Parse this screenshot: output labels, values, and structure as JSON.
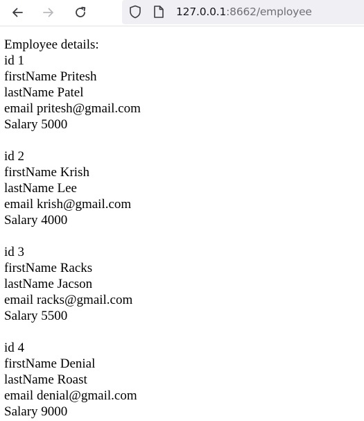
{
  "browser": {
    "url_host": "127.0.0.1",
    "url_rest": ":8662/employee"
  },
  "page": {
    "heading": "Employee details:",
    "employees": [
      {
        "id": "id 1",
        "first": "firstName Pritesh",
        "last": "lastName Patel",
        "email": "email pritesh@gmail.com",
        "salary": "Salary 5000"
      },
      {
        "id": "id 2",
        "first": "firstName Krish",
        "last": "lastName Lee",
        "email": "email krish@gmail.com",
        "salary": "Salary 4000"
      },
      {
        "id": "id 3",
        "first": "firstName Racks",
        "last": "lastName Jacson",
        "email": "email racks@gmail.com",
        "salary": "Salary 5500"
      },
      {
        "id": "id 4",
        "first": "firstName Denial",
        "last": "lastName Roast",
        "email": "email denial@gmail.com",
        "salary": "Salary 9000"
      }
    ]
  }
}
